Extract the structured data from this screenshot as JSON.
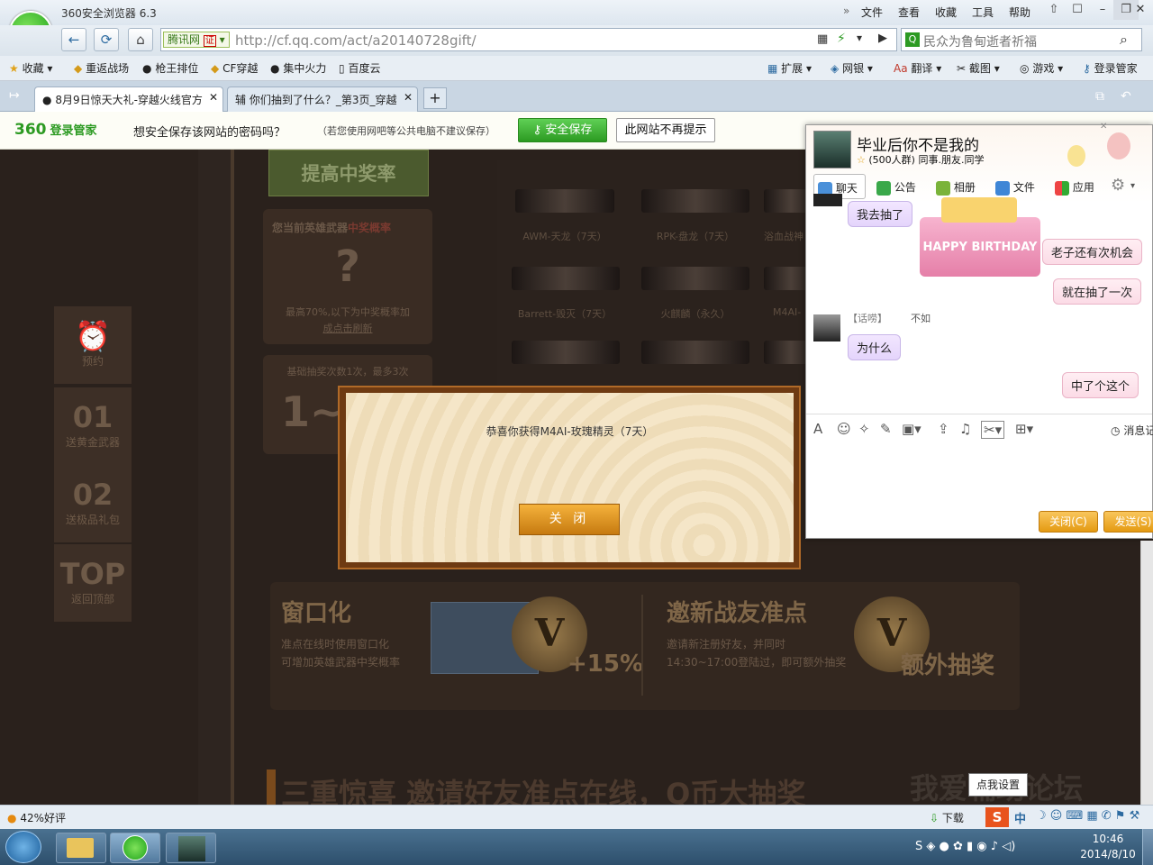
{
  "browser": {
    "title": "360安全浏览器 6.3",
    "menu": [
      "文件",
      "查看",
      "收藏",
      "工具",
      "帮助"
    ],
    "window_controls": [
      "⇧",
      "☐",
      "–",
      "❐",
      "✕"
    ],
    "nav": {
      "back": "←",
      "refresh": "⟳",
      "home": "⌂"
    },
    "address": {
      "badge": "腾讯网",
      "cert": "证",
      "url": "http://cf.qq.com/act/a20140728gift/"
    },
    "search": {
      "text": "民众为鲁甸逝者祈福"
    },
    "favorites": [
      "收藏",
      "重返战场",
      "枪王排位",
      "CF穿越",
      "集中火力",
      "百度云"
    ],
    "toolbar_right": [
      "扩展",
      "网银",
      "翻译",
      "截图",
      "游戏",
      "登录管家"
    ],
    "tabs": [
      {
        "label": "8月9日惊天大礼-穿越火线官方"
      },
      {
        "label": "你们抽到了什么？_第3页_穿越"
      }
    ],
    "new_tab": "+"
  },
  "password_bar": {
    "brand": "360",
    "brand_sub": "登录管家",
    "question": "想安全保存该网站的密码吗？",
    "hint": "（若您使用网吧等公共电脑不建议保存）",
    "save_label": "安全保存",
    "never_label": "此网站不再提示"
  },
  "page": {
    "sidebar": [
      {
        "big": "⏰",
        "small": "预约"
      },
      {
        "big": "01",
        "small": "送黄金武器"
      },
      {
        "big": "02",
        "small": "送极品礼包"
      },
      {
        "big": "TOP",
        "small": "返回顶部"
      }
    ],
    "raise_rate": "提高中奖率",
    "hero_title": "您当前英雄武器",
    "hero_title_red": "中奖概率",
    "hero_mark": "?",
    "hero_desc": "最高70%,以下为中奖概率加",
    "hero_link": "成点击刷新",
    "draw_count_text": "基础抽奖次数1次，最多3次",
    "draw_count_big": "1~",
    "weapons": [
      {
        "name": "AWM-天龙（7天）"
      },
      {
        "name": "RPK-盘龙（7天）"
      },
      {
        "name": "浴血战神"
      },
      {
        "name": "Barrett-毁灭（7天）"
      },
      {
        "name": "火麒麟（永久）"
      },
      {
        "name": "M4AI-"
      }
    ],
    "promo_left_title": "窗口化",
    "promo_left_desc1": "准点在线时使用窗口化",
    "promo_left_desc2": "可增加英雄武器中奖概率",
    "promo_left_bonus": "+15%",
    "promo_right_title": "邀新战友准点",
    "promo_right_desc1": "邀请新注册好友，并同时",
    "promo_right_desc2": "14:30~17:00登陆过，即可额外抽奖",
    "promo_right_bonus": "额外抽奖",
    "coin_letter": "V",
    "banner": "三重惊喜 邀请好友准点在线，Q币大抽奖",
    "watermark": "我爱辅助论坛"
  },
  "modal": {
    "message": "恭喜你获得M4AI-玫瑰精灵（7天）",
    "close_label": "关  闭"
  },
  "chat": {
    "group_name": "毕业后你不是我的",
    "group_sub": "(500人群) 同事.朋友.同学",
    "tabs": [
      "聊天",
      "公告",
      "相册",
      "文件",
      "应用"
    ],
    "cake_text": "HAPPY BIRTHDAY",
    "messages": [
      {
        "text": "我去抽了",
        "side": "left"
      },
      {
        "text": "老子还有次机会",
        "side": "right"
      },
      {
        "text": "就在抽了一次",
        "side": "right"
      },
      {
        "text": "为什么",
        "side": "left"
      },
      {
        "text": "中了个这个",
        "side": "right"
      }
    ],
    "sender_tag": "【话唠】",
    "sender_name": "不如",
    "history_label": "消息记录",
    "close_btn": "关闭(C)",
    "send_btn": "发送(S)"
  },
  "status": {
    "rating": "42%好评",
    "download": "下载",
    "tooltip": "点我设置",
    "ime": "中"
  },
  "taskbar": {
    "time": "10:46",
    "date": "2014/8/10"
  },
  "colors": {
    "brand_green": "#2c9a22",
    "modal_gold": "#e49a12",
    "page_bg": "#2a211c"
  }
}
